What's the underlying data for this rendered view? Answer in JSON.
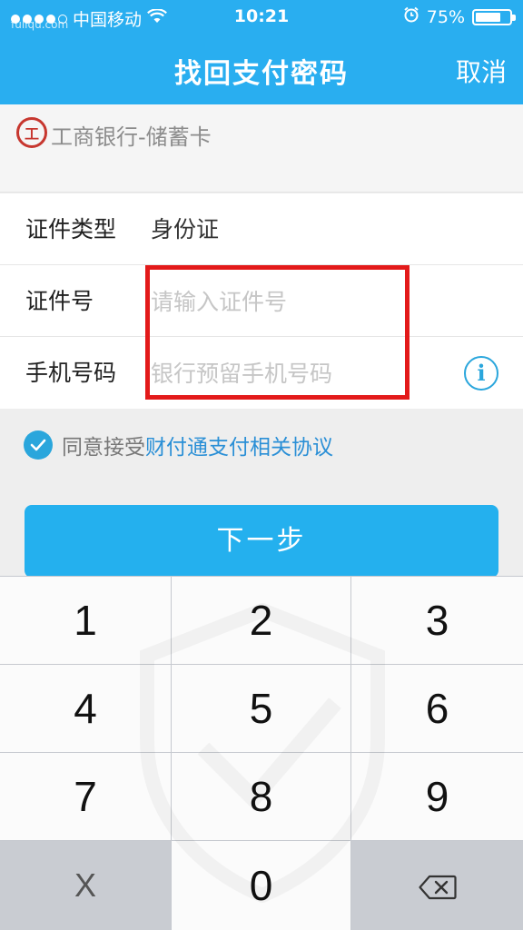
{
  "status_bar": {
    "carrier": "中国移动",
    "time": "10:21",
    "battery_percent": "75%",
    "battery_level": 0.75,
    "watermark": "fuliqu.com"
  },
  "nav": {
    "title": "找回支付密码",
    "cancel": "取消"
  },
  "bank": {
    "logo_char": "工",
    "name": "工商银行-储蓄卡"
  },
  "form": {
    "id_type_label": "证件类型",
    "id_type_value": "身份证",
    "id_number_label": "证件号",
    "id_number_placeholder": "请输入证件号",
    "phone_label": "手机号码",
    "phone_placeholder": "银行预留手机号码",
    "info_icon": "i"
  },
  "agreement": {
    "prefix": "同意接受",
    "link": "财付通支付相关协议",
    "checked": true
  },
  "next_button": "下一步",
  "keypad": {
    "keys": [
      "1",
      "2",
      "3",
      "4",
      "5",
      "6",
      "7",
      "8",
      "9",
      "X",
      "0",
      "⌫"
    ]
  },
  "colors": {
    "header": "#29aef0",
    "accent": "#2aa6dc",
    "highlight": "#e31a1a",
    "button": "#24b0ee"
  }
}
